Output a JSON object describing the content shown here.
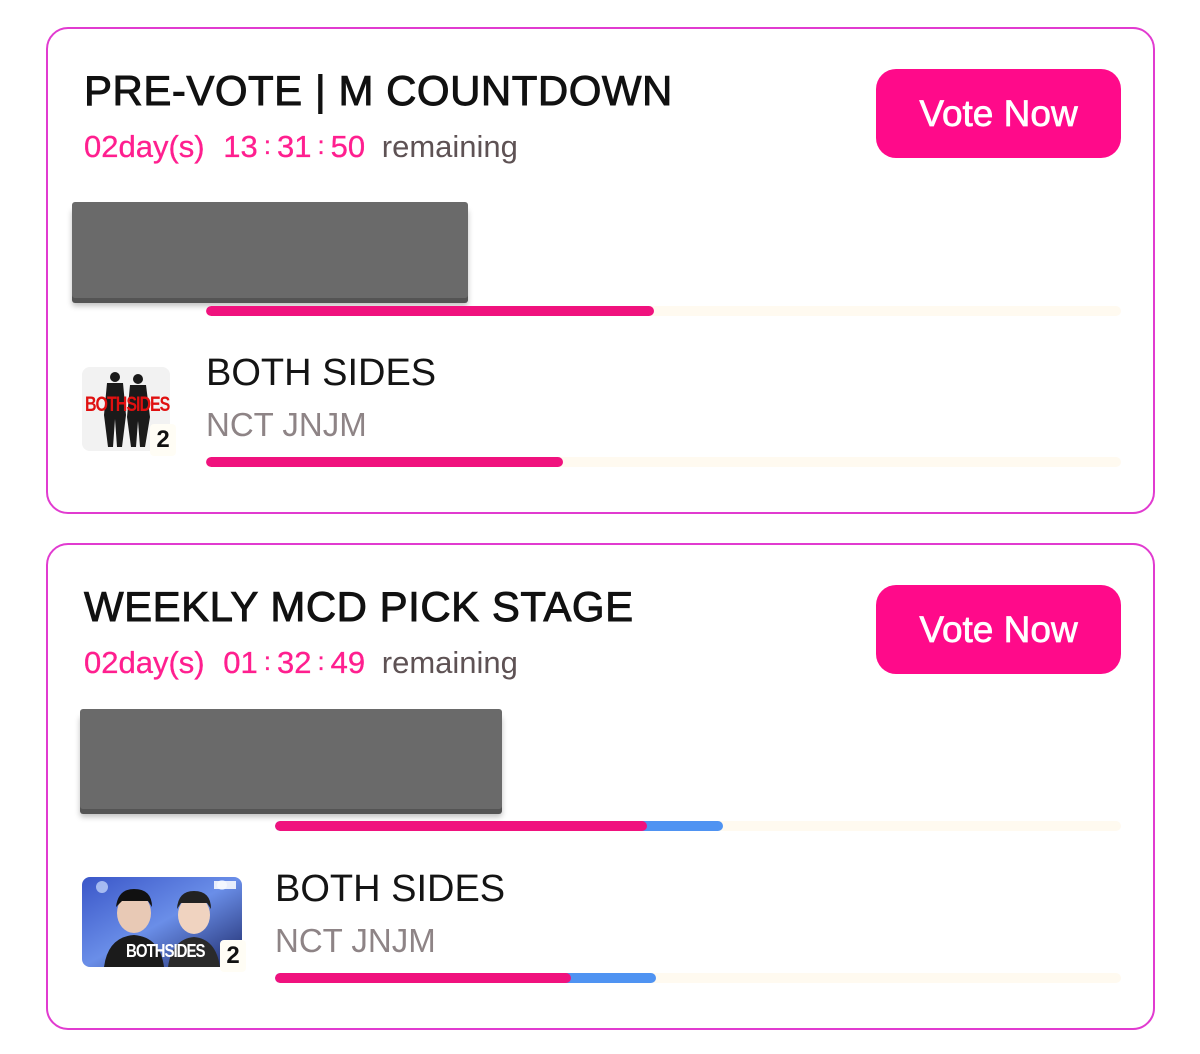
{
  "cards": [
    {
      "title": "PRE-VOTE | M COUNTDOWN",
      "countdown": {
        "days": "02day(s)",
        "hours": "13",
        "minutes": "31",
        "seconds": "50",
        "suffix": "remaining"
      },
      "vote_button": "Vote Now",
      "overall_progress": {
        "pink": 0.49
      },
      "entry": {
        "song": "BOTH SIDES",
        "artist": "NCT JNJM",
        "rank": "2",
        "thumb_text": "BOTHSIDES",
        "progress": {
          "pink": 0.39
        }
      }
    },
    {
      "title": "WEEKLY MCD PICK STAGE",
      "countdown": {
        "days": "02day(s)",
        "hours": "01",
        "minutes": "32",
        "seconds": "49",
        "suffix": "remaining"
      },
      "vote_button": "Vote Now",
      "overall_progress": {
        "pink": 0.44,
        "blue": 0.53
      },
      "entry": {
        "song": "BOTH SIDES",
        "artist": "NCT JNJM",
        "rank": "2",
        "thumb_text": "BOTHSIDES",
        "progress": {
          "pink": 0.35,
          "blue": 0.45
        }
      }
    }
  ],
  "colors": {
    "accent": "#ff0a8a",
    "border": "#e13bd0",
    "blue": "#4f93f2",
    "redaction": "#6a6a6a"
  },
  "icons": {
    "sep": ":"
  }
}
